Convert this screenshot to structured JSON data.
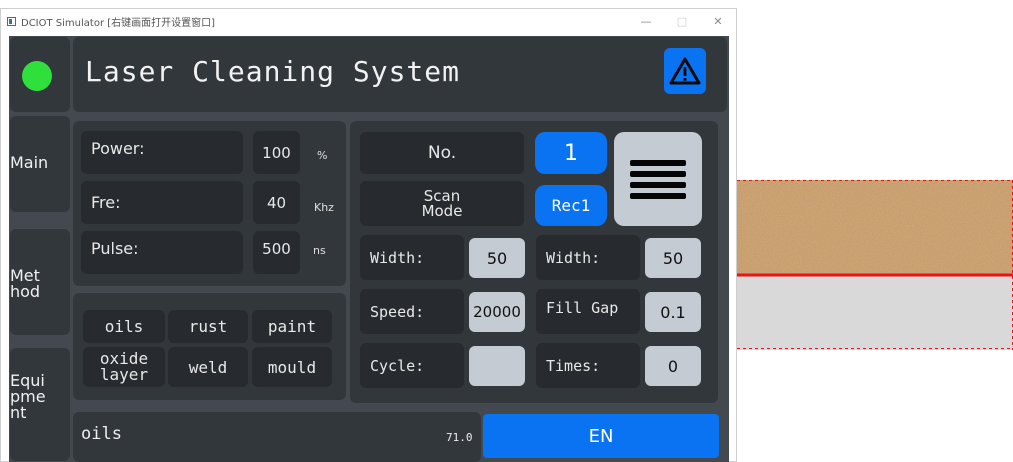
{
  "window": {
    "title": "DCIOT Simulator [右键画面打开设置窗口]",
    "minimize_glyph": "—",
    "maximize_glyph": "□",
    "close_glyph": "✕"
  },
  "header": {
    "title": "Laser Cleaning System"
  },
  "sidebar": {
    "main_label": "Main",
    "method_label": "Method",
    "equipment_label": "Equipment"
  },
  "laser_params": {
    "power": {
      "label": "Power:",
      "value": "100",
      "unit": "%"
    },
    "fre": {
      "label": "Fre:",
      "value": "40",
      "unit": "Khz"
    },
    "pulse": {
      "label": "Pulse:",
      "value": "500",
      "unit": "ns"
    }
  },
  "materials": [
    "oils",
    "rust",
    "paint",
    "oxide layer",
    "weld",
    "mould"
  ],
  "status": {
    "material": "oils",
    "value": "71.0",
    "lang_button": "EN"
  },
  "scan": {
    "no_label": "No.",
    "no_value": "1",
    "mode_label": "Scan Mode",
    "mode_value": "Rec1",
    "width1_label": "Width:",
    "width1_value": "50",
    "width2_label": "Width:",
    "width2_value": "50",
    "speed_label": "Speed:",
    "speed_value": "20000",
    "fillgap_label": "Fill Gap",
    "fillgap_value": "0.1",
    "cycle_label": "Cycle:",
    "cycle_value": "",
    "times_label": "Times:",
    "times_value": "0"
  },
  "colors": {
    "screen_bg": "#444950",
    "panel": "#32373c",
    "button": "#272b2f",
    "value_box": "#c4cbd2",
    "accent_blue": "#0a73f2",
    "status_green": "#2fe03d",
    "preview_line": "#e8141a"
  },
  "icons": [
    "app-icon",
    "warning-icon",
    "menu-lines-icon",
    "status-led"
  ]
}
